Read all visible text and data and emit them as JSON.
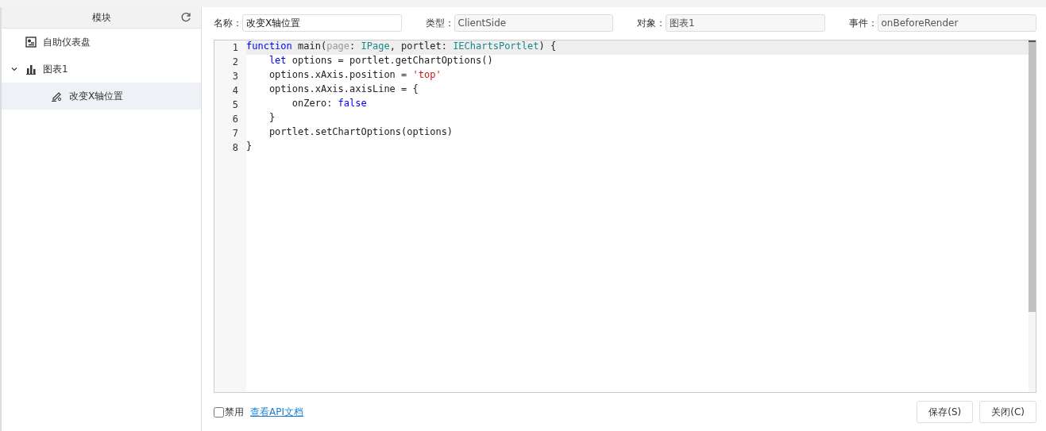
{
  "sidebar": {
    "header": "模块",
    "tree": [
      {
        "label": "自助仪表盘",
        "kind": "dashboard",
        "selected": false
      },
      {
        "label": "图表1",
        "kind": "chart",
        "selected": false,
        "expanded": true,
        "children": [
          {
            "label": "改变X轴位置",
            "kind": "script",
            "selected": true
          }
        ]
      }
    ]
  },
  "fields": [
    {
      "label": "名称：",
      "value": "改变X轴位置",
      "disabled": false
    },
    {
      "label": "类型：",
      "value": "ClientSide",
      "disabled": true
    },
    {
      "label": "对象：",
      "value": "图表1",
      "disabled": true
    },
    {
      "label": "事件：",
      "value": "onBeforeRender",
      "disabled": true
    }
  ],
  "editor": {
    "lines": [
      {
        "number": "1",
        "active": true,
        "tokens": [
          {
            "text": "function",
            "kind": "keyword"
          },
          {
            "text": " main(",
            "kind": "plain"
          },
          {
            "text": "page",
            "kind": "param"
          },
          {
            "text": ": ",
            "kind": "plain"
          },
          {
            "text": "IPage",
            "kind": "type"
          },
          {
            "text": ", portlet: ",
            "kind": "plain"
          },
          {
            "text": "IEChartsPortlet",
            "kind": "type"
          },
          {
            "text": ") {",
            "kind": "plain"
          }
        ]
      },
      {
        "number": "2",
        "active": false,
        "tokens": [
          {
            "text": "    let",
            "kind": "keyword"
          },
          {
            "text": " options = portlet.getChartOptions()",
            "kind": "plain"
          }
        ]
      },
      {
        "number": "3",
        "active": false,
        "tokens": [
          {
            "text": "    options.xAxis.position = ",
            "kind": "plain"
          },
          {
            "text": "'top'",
            "kind": "string"
          }
        ]
      },
      {
        "number": "4",
        "active": false,
        "tokens": [
          {
            "text": "    options.xAxis.axisLine = {",
            "kind": "plain"
          }
        ]
      },
      {
        "number": "5",
        "active": false,
        "tokens": [
          {
            "text": "        onZero: ",
            "kind": "plain"
          },
          {
            "text": "false",
            "kind": "keyword"
          }
        ]
      },
      {
        "number": "6",
        "active": false,
        "tokens": [
          {
            "text": "    }",
            "kind": "plain"
          }
        ]
      },
      {
        "number": "7",
        "active": false,
        "tokens": [
          {
            "text": "    portlet.setChartOptions(options)",
            "kind": "plain"
          }
        ]
      },
      {
        "number": "8",
        "active": false,
        "tokens": [
          {
            "text": "}",
            "kind": "plain"
          }
        ]
      }
    ]
  },
  "footer": {
    "disable_checkbox": {
      "label": "禁用",
      "checked": false
    },
    "api_link": "查看API文档",
    "buttons": [
      "保存(S)",
      "关闭(C)"
    ]
  }
}
